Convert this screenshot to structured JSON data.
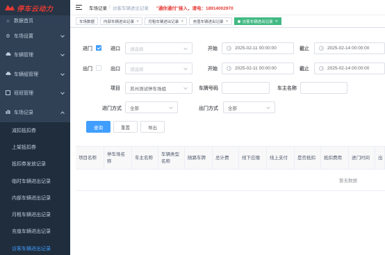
{
  "logo": {
    "text": "停车云动力"
  },
  "sidebar": {
    "items": [
      {
        "label": "数据首页",
        "icon": "home-icon"
      },
      {
        "label": "车场设置",
        "icon": "gear-icon"
      },
      {
        "label": "车辆管理",
        "icon": "car-icon"
      },
      {
        "label": "车辆组管理",
        "icon": "car-group-icon"
      },
      {
        "label": "班班管理",
        "icon": "grid-icon"
      },
      {
        "label": "车场记录",
        "icon": "bar-chart-icon"
      }
    ],
    "subitems": [
      {
        "label": "减扣抵扣券"
      },
      {
        "label": "上架抵扣券"
      },
      {
        "label": "抵扣券发放记录"
      },
      {
        "label": "临时车辆进出记录"
      },
      {
        "label": "内部车辆进出记录"
      },
      {
        "label": "月租车辆进出记录"
      },
      {
        "label": "充值车辆进出记录"
      },
      {
        "label": "访客车辆进出记录"
      }
    ]
  },
  "header": {
    "breadcrumb_parent": "车场记录",
    "breadcrumb_sep": "/",
    "breadcrumb_current": "访客车辆进出记录",
    "notice": "\"通你通付\"接入，请电：18914002970"
  },
  "tags": [
    {
      "label": "车场数据"
    },
    {
      "label": "内部车辆进出记录"
    },
    {
      "label": "月租车辆进出记录"
    },
    {
      "label": "充值车辆进出记录"
    },
    {
      "label": "访客车辆进出记录"
    }
  ],
  "form": {
    "entry_label": "进门",
    "entry_gate_label": "进口",
    "entry_gate_placeholder": "请选择",
    "start_label": "开始",
    "start_value_1": "2025-02-11 00:00:00",
    "end_label": "截止",
    "end_value_1": "2025-02-14 00:00:00",
    "exit_label": "出门",
    "exit_gate_label": "出口",
    "exit_gate_placeholder": "请选择",
    "start_value_2": "2025-02-11 00:00:00",
    "end_value_2": "2025-02-14 00:00:00",
    "project_label": "项目",
    "project_value": "苏州测试停车场组",
    "plate_label": "车牌号码",
    "owner_label": "车主名称",
    "entry_method_label": "进门方式",
    "entry_method_value": "全部",
    "exit_method_label": "出门方式",
    "exit_method_value": "全部",
    "query_button": "查询",
    "reset_button": "重置",
    "export_button": "导出"
  },
  "table": {
    "headers": [
      "项目名称",
      "停车场名称",
      "车主名称",
      "车辆类型名称",
      "随路车牌",
      "总计费",
      "线下应缴",
      "线上支付",
      "是否抵扣",
      "抵扣费用",
      "进门时间",
      "出"
    ],
    "empty_text": "暂无数据"
  }
}
